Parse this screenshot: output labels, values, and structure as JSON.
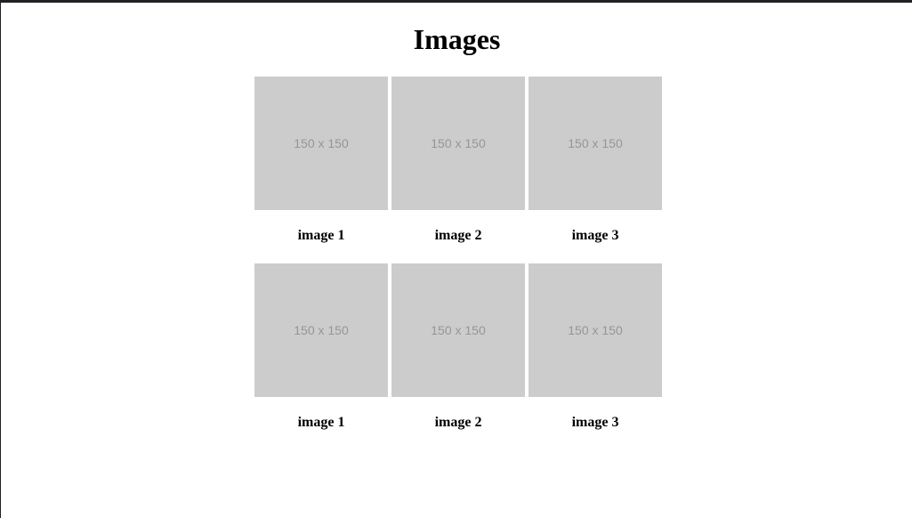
{
  "page": {
    "title": "Images"
  },
  "gallery": {
    "rows": [
      {
        "items": [
          {
            "placeholder": "150 x 150",
            "caption": "image 1"
          },
          {
            "placeholder": "150 x 150",
            "caption": "image 2"
          },
          {
            "placeholder": "150 x 150",
            "caption": "image 3"
          }
        ]
      },
      {
        "items": [
          {
            "placeholder": "150 x 150",
            "caption": "image 1"
          },
          {
            "placeholder": "150 x 150",
            "caption": "image 2"
          },
          {
            "placeholder": "150 x 150",
            "caption": "image 3"
          }
        ]
      }
    ]
  },
  "colors": {
    "placeholder_bg": "#cccccc",
    "placeholder_text": "#969696",
    "top_border": "#202124"
  }
}
